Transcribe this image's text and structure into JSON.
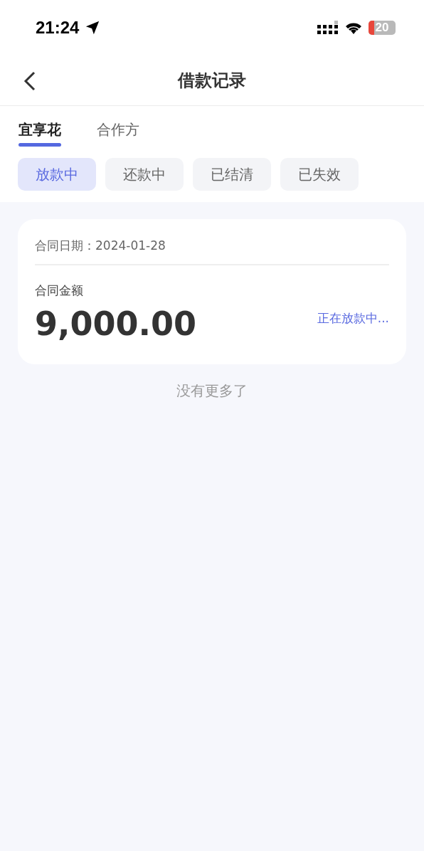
{
  "status_bar": {
    "time": "21:24",
    "battery": "20"
  },
  "nav": {
    "title": "借款记录"
  },
  "tabs": [
    {
      "label": "宜享花",
      "selected": true
    },
    {
      "label": "合作方",
      "selected": false
    }
  ],
  "filters": [
    {
      "label": "放款中",
      "selected": true
    },
    {
      "label": "还款中",
      "selected": false
    },
    {
      "label": "已结清",
      "selected": false
    },
    {
      "label": "已失效",
      "selected": false
    }
  ],
  "records": [
    {
      "date_label": "合同日期：",
      "date": "2024-01-28",
      "amount_label": "合同金额",
      "amount": "9,000.00",
      "status": "正在放款中..."
    }
  ],
  "footer": "没有更多了"
}
